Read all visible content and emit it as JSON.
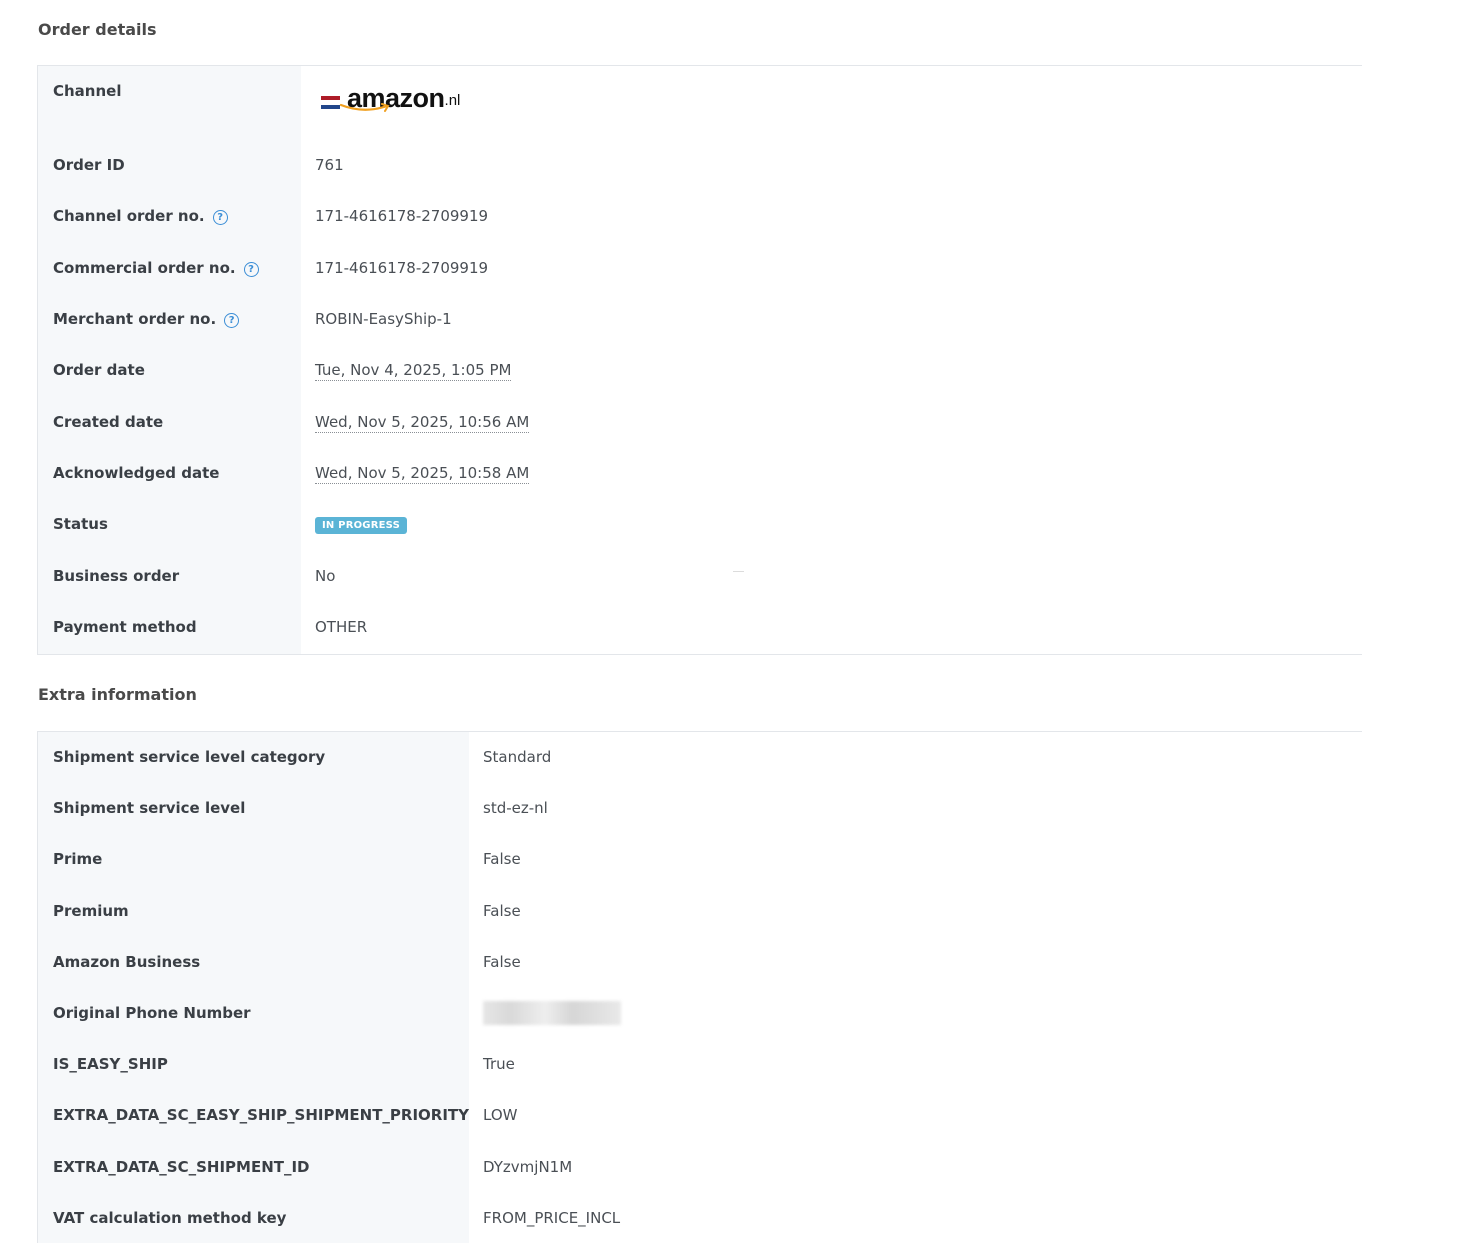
{
  "order_details": {
    "title": "Order details",
    "channel_label": "Channel",
    "channel_logo": {
      "word": "amazon",
      "tld": ".nl",
      "flag": [
        "#ae1c28",
        "#ffffff",
        "#21468b"
      ]
    },
    "rows": [
      {
        "label": "Order ID",
        "value": "761"
      },
      {
        "label": "Channel order no.",
        "value": "171-4616178-2709919"
      },
      {
        "label": "Commercial order no.",
        "value": "171-4616178-2709919"
      },
      {
        "label": "Merchant order no.",
        "value": "ROBIN-EasyShip-1"
      },
      {
        "label": "Order date",
        "value": "Tue, Nov 4, 2025, 1:05 PM"
      },
      {
        "label": "Created date",
        "value": "Wed, Nov 5, 2025, 10:56 AM"
      },
      {
        "label": "Acknowledged date",
        "value": "Wed, Nov 5, 2025, 10:58 AM"
      },
      {
        "label": "Status",
        "value": "IN PROGRESS"
      },
      {
        "label": "Business order",
        "value": "No"
      },
      {
        "label": "Payment method",
        "value": "OTHER"
      }
    ],
    "help_icon": "?"
  },
  "extra_information": {
    "title": "Extra information",
    "rows": [
      {
        "label": "Shipment service level category",
        "value": "Standard"
      },
      {
        "label": "Shipment service level",
        "value": "std-ez-nl"
      },
      {
        "label": "Prime",
        "value": "False"
      },
      {
        "label": "Premium",
        "value": "False"
      },
      {
        "label": "Amazon Business",
        "value": "False"
      },
      {
        "label": "Original Phone Number",
        "value": ""
      },
      {
        "label": "IS_EASY_SHIP",
        "value": "True"
      },
      {
        "label": "EXTRA_DATA_SC_EASY_SHIP_SHIPMENT_PRIORITY",
        "value": "LOW"
      },
      {
        "label": "EXTRA_DATA_SC_SHIPMENT_ID",
        "value": "DYzvmjN1M"
      },
      {
        "label": "VAT calculation method key",
        "value": "FROM_PRICE_INCL"
      }
    ]
  },
  "colors": {
    "status_badge": "#5bb4d6",
    "help_icon": "#3b8ed6",
    "label_bg": "#f6f8fa"
  }
}
